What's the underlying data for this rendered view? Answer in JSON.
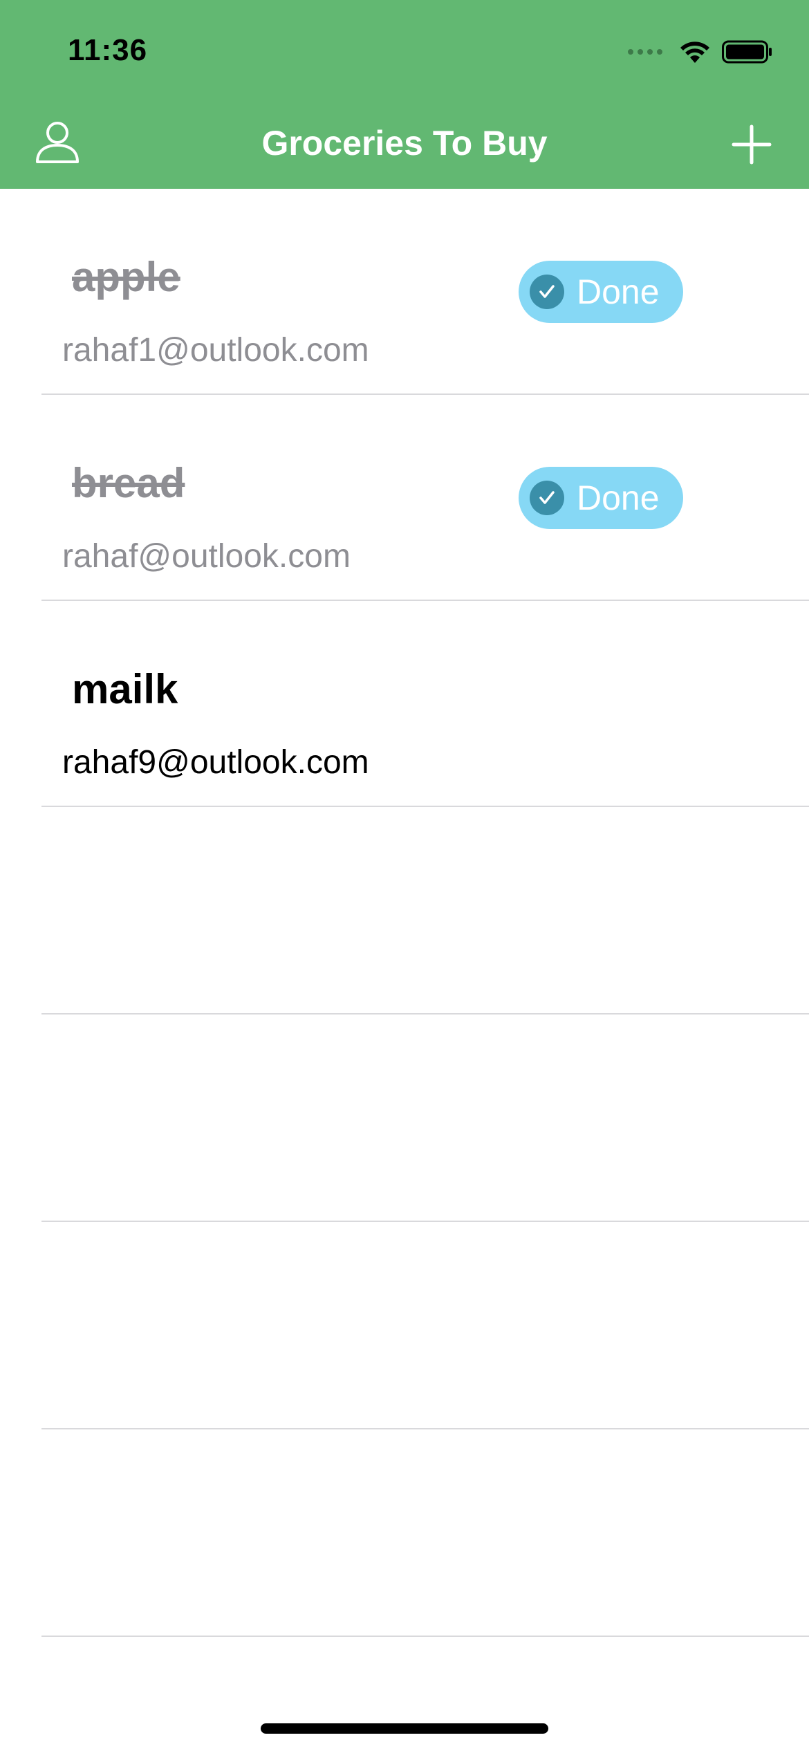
{
  "status_bar": {
    "time": "11:36"
  },
  "nav": {
    "title": "Groceries To Buy",
    "left_icon": "person-icon",
    "right_icon": "plus-icon"
  },
  "items": [
    {
      "name": "apple",
      "email": "rahaf1@outlook.com",
      "completed": true,
      "badge_label": "Done"
    },
    {
      "name": "bread",
      "email": "rahaf@outlook.com",
      "completed": true,
      "badge_label": "Done"
    },
    {
      "name": "mailk",
      "email": "rahaf9@outlook.com",
      "completed": false
    }
  ],
  "colors": {
    "header": "#62b872",
    "badge": "#86d8f5",
    "badge_check": "#3a8fa9",
    "done_text": "#8e8e93"
  }
}
